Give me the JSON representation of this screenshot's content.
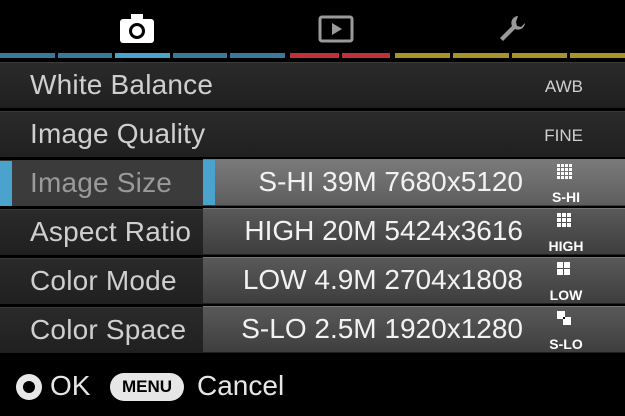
{
  "tabs": [
    {
      "icon": "camera-icon",
      "color": "#4aa3cc"
    },
    {
      "icon": "playback-icon",
      "color": "#c0303a"
    },
    {
      "icon": "wrench-icon",
      "color": "#a8922a"
    }
  ],
  "menu": {
    "items": [
      {
        "label": "White Balance",
        "value": "AWB"
      },
      {
        "label": "Image Quality",
        "value": "FINE"
      },
      {
        "label": "Image Size",
        "value": ""
      },
      {
        "label": "Aspect Ratio",
        "value": ""
      },
      {
        "label": "Color Mode",
        "value": ""
      },
      {
        "label": "Color Space",
        "value": ""
      }
    ],
    "active_index": 2
  },
  "dropdown": {
    "options": [
      {
        "text": "S-HI 39M 7680x5120",
        "icon_tag": "S-HI"
      },
      {
        "text": "HIGH 20M 5424x3616",
        "icon_tag": "HIGH"
      },
      {
        "text": "LOW 4.9M 2704x1808",
        "icon_tag": "LOW"
      },
      {
        "text": "S-LO 2.5M 1920x1280",
        "icon_tag": "S-LO"
      }
    ],
    "selected_index": 0
  },
  "footer": {
    "ok_label": "OK",
    "menu_button": "MENU",
    "cancel_label": "Cancel"
  },
  "colors": {
    "accent": "#4aa3cc",
    "play": "#c0303a",
    "setup": "#a8922a"
  }
}
